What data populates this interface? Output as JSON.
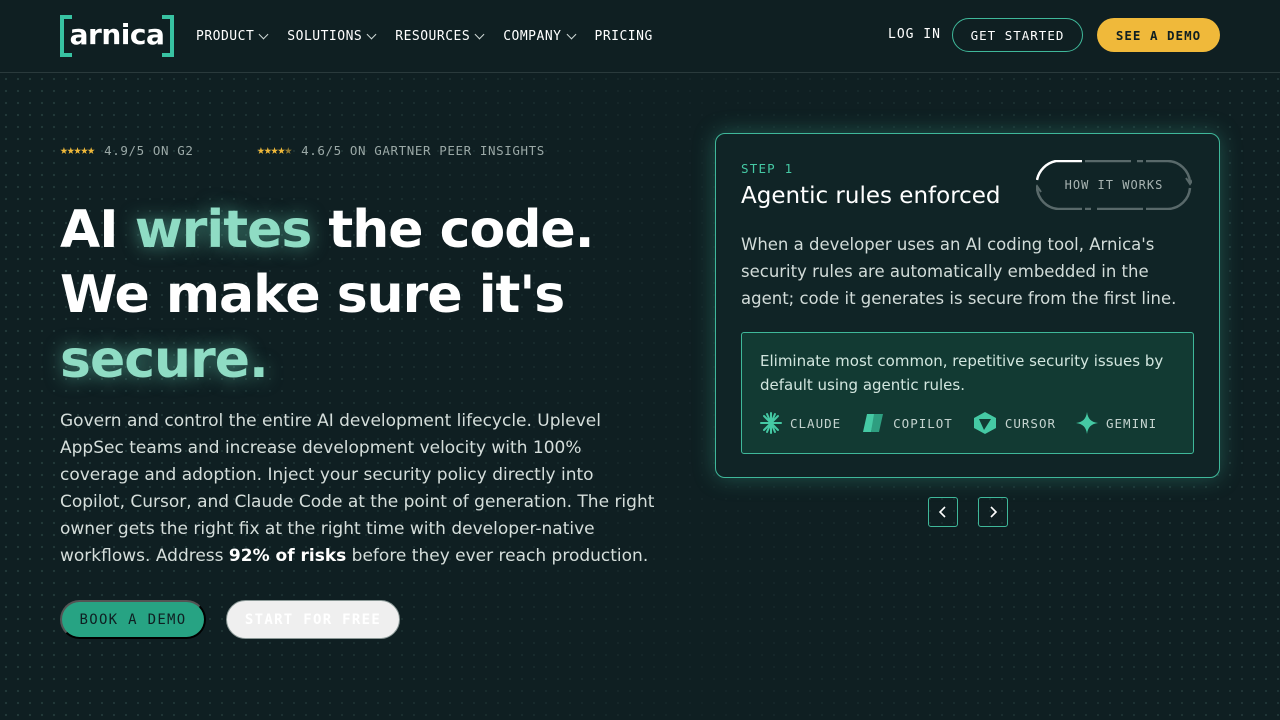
{
  "brand": {
    "name": "arnica",
    "accent": "#38c2a2",
    "cta": "#f0b93a",
    "background": "#0f1f22"
  },
  "nav": {
    "items": [
      {
        "label": "PRODUCT",
        "has_dropdown": true
      },
      {
        "label": "SOLUTIONS",
        "has_dropdown": true
      },
      {
        "label": "RESOURCES",
        "has_dropdown": true
      },
      {
        "label": "COMPANY",
        "has_dropdown": true
      },
      {
        "label": "PRICING",
        "has_dropdown": false
      }
    ],
    "login": "LOG IN",
    "get_started": "GET STARTED",
    "see_demo": "SEE A DEMO"
  },
  "ratings": [
    {
      "score": "4.9/5 ON G2",
      "stars": 5
    },
    {
      "score": "4.6/5 ON GARTNER PEER INSIGHTS",
      "stars": 4.5
    }
  ],
  "hero": {
    "line1_a": "AI ",
    "line1_highlight": "writes",
    "line1_b": " the code.",
    "line2": "We make sure it's",
    "line3_highlight": "secure.",
    "description": "Govern and control the entire AI development lifecycle. Uplevel AppSec teams and increase development velocity with 100% coverage and adoption. Inject your security policy directly into Copilot, Cursor, and Claude Code at the point of generation. The right owner gets the right fix at the right time with developer-native workflows. Address ",
    "description_bold": "92% of risks",
    "description_end": " before they ever reach production.",
    "book_demo": "BOOK A DEMO",
    "start_free": "START FOR FREE"
  },
  "card": {
    "step": "STEP 1",
    "title": "Agentic rules enforced",
    "how_it_works": "HOW IT WORKS",
    "body": "When a developer uses an AI coding tool, Arnica's security rules are automatically embedded in the agent; code it generates is secure from the first line.",
    "callout": "Eliminate most common, repetitive security issues by default using agentic rules.",
    "tools": [
      {
        "label": "CLAUDE",
        "icon": "claude-icon"
      },
      {
        "label": "COPILOT",
        "icon": "copilot-icon"
      },
      {
        "label": "CURSOR",
        "icon": "cursor-icon"
      },
      {
        "label": "GEMINI",
        "icon": "gemini-icon"
      }
    ]
  },
  "carousel": {
    "prev_icon": "chevron-left-icon",
    "next_icon": "chevron-right-icon"
  }
}
